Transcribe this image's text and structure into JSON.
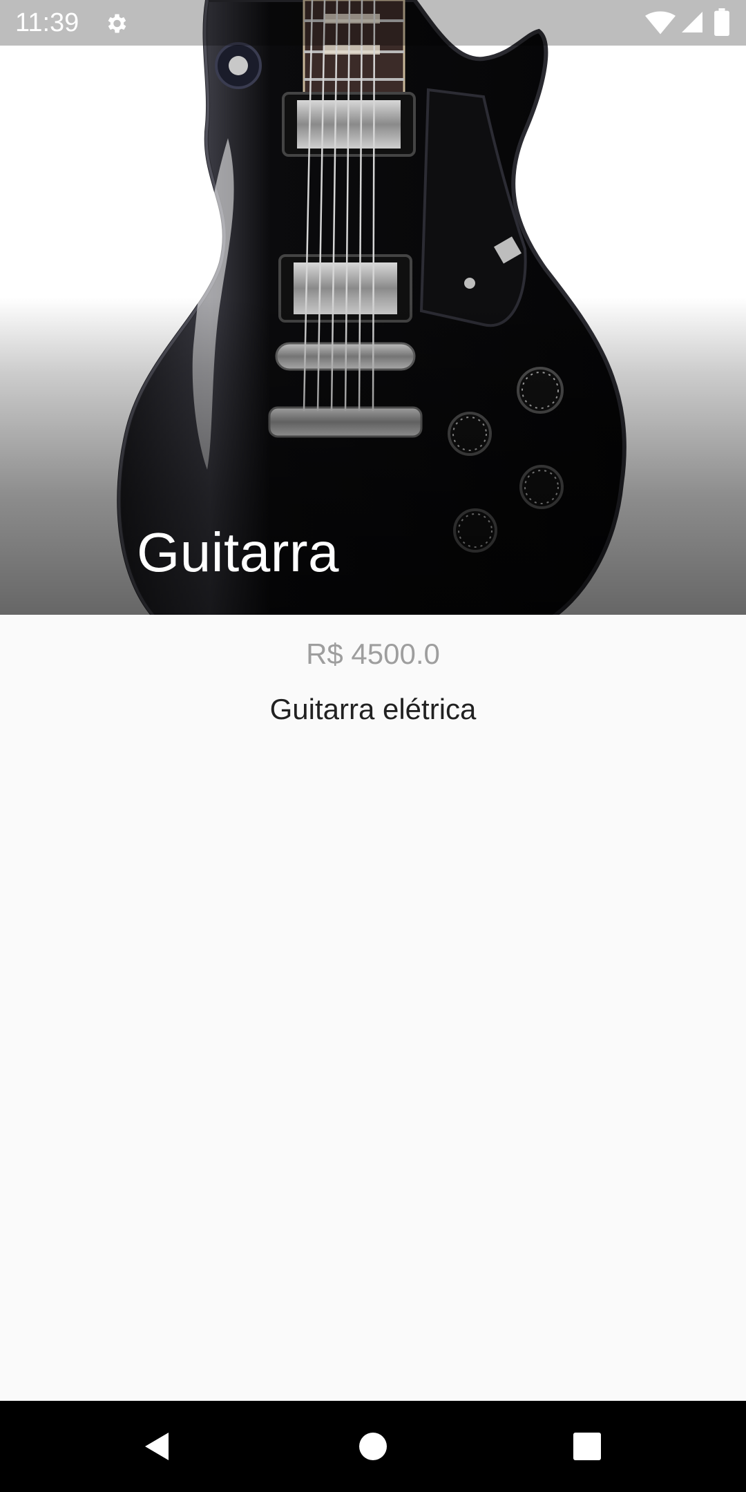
{
  "status_bar": {
    "time": "11:39",
    "icons": [
      "settings-icon",
      "wifi-icon",
      "signal-icon",
      "battery-icon"
    ]
  },
  "product": {
    "title": "Guitarra",
    "price": "R$ 4500.0",
    "description": "Guitarra elétrica",
    "image": "electric-guitar-photo"
  },
  "nav_bar": {
    "buttons": [
      "back-icon",
      "home-icon",
      "recents-icon"
    ]
  },
  "colors": {
    "background": "#fafafa",
    "price_text": "#9e9e9e",
    "description_text": "#212121",
    "title_text": "#ffffff",
    "nav_bar": "#000000"
  }
}
